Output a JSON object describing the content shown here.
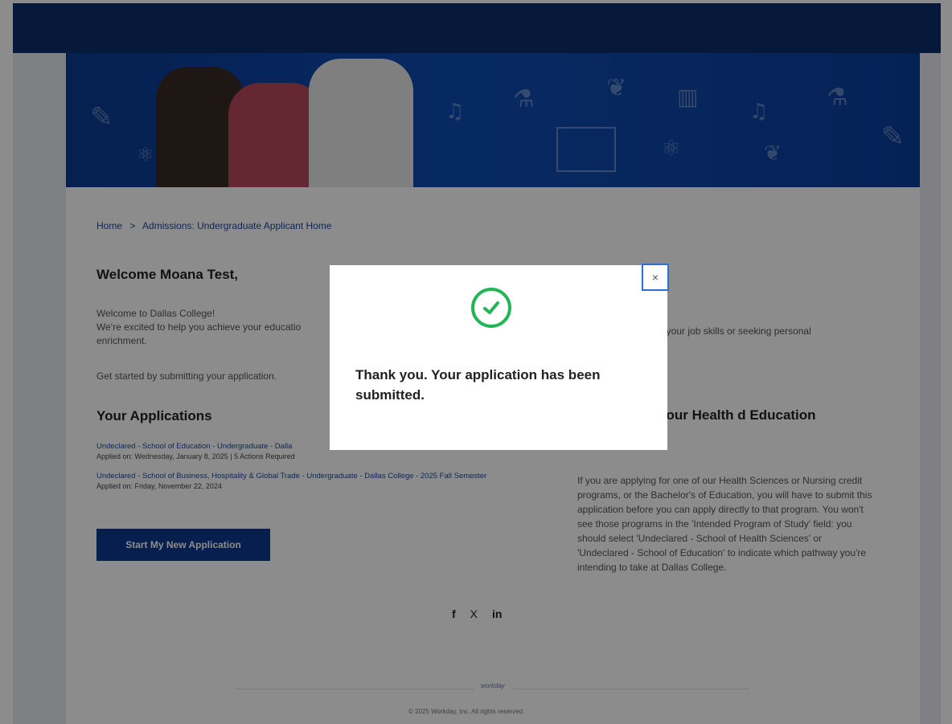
{
  "breadcrumb": {
    "home": "Home",
    "separator": ">",
    "current": "Admissions: Undergraduate Applicant Home"
  },
  "welcome": {
    "title": "Welcome Moana Test,",
    "line1": "Welcome to Dallas College!",
    "line2": "We're excited to help you achieve your educatio",
    "line2_tail": "ng your job skills or seeking personal",
    "line3": "enrichment.",
    "line4": "Get started by submitting your application."
  },
  "applications": {
    "title": "Your Applications",
    "items": [
      {
        "link": "Undeclared - School of Education - Undergraduate - Dalla",
        "meta": "Applied on: Wednesday, January 8, 2025 | 5 Actions Required"
      },
      {
        "link": "Undeclared - School of Business, Hospitality & Global Trade - Undergraduate - Dallas College - 2025 Fall Semester",
        "meta": "Applied on: Friday, November 22, 2024"
      }
    ],
    "start_button": "Start My New Application"
  },
  "info": {
    "title": "formation for our Health d Education Applicants:",
    "body": "If you are applying for one of our Health Sciences or Nursing credit programs, or the Bachelor's of Education, you will have to submit this application before you can apply directly to that program. You won't see those programs in the 'Intended Program of Study' field: you should select 'Undeclared - School of Health Sciences' or 'Undeclared - School of Education' to indicate which pathway you're intending to take at Dallas College."
  },
  "social": {
    "facebook": "f",
    "x": "X",
    "linkedin": "in"
  },
  "footer": {
    "logo": "workday",
    "copyright": "© 2025 Workday, Inc. All rights reserved."
  },
  "modal": {
    "close_symbol": "×",
    "message": "Thank you. Your application has been submitted."
  },
  "colors": {
    "brand_navy": "#0b2f6b",
    "hero_blue": "#0e4cb4",
    "button_blue": "#0b3a8f",
    "link_blue": "#1b4aa0",
    "success_green": "#22b556",
    "close_border": "#2d6fd6"
  },
  "icons": {
    "success": "check-circle-icon",
    "close": "close-icon"
  }
}
